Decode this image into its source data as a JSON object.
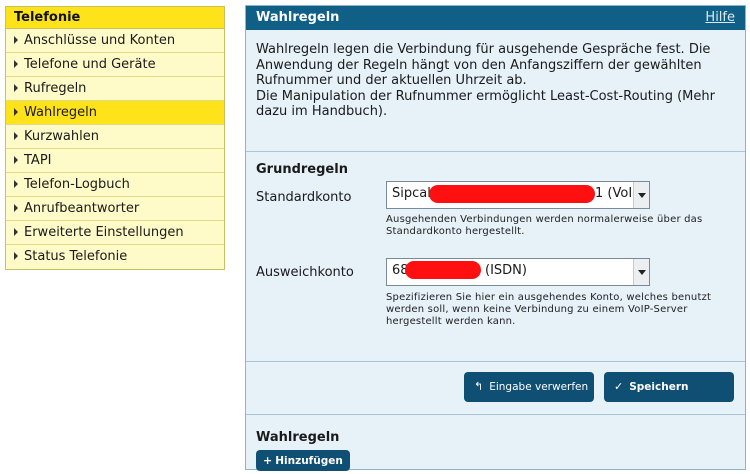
{
  "nav": {
    "title": "Telefonie",
    "items": [
      {
        "label": "Anschlüsse und Konten",
        "active": false
      },
      {
        "label": "Telefone und Geräte",
        "active": false
      },
      {
        "label": "Rufregeln",
        "active": false
      },
      {
        "label": "Wahlregeln",
        "active": true
      },
      {
        "label": "Kurzwahlen",
        "active": false
      },
      {
        "label": "TAPI",
        "active": false
      },
      {
        "label": "Telefon-Logbuch",
        "active": false
      },
      {
        "label": "Anrufbeantworter",
        "active": false
      },
      {
        "label": "Erweiterte Einstellungen",
        "active": false
      },
      {
        "label": "Status Telefonie",
        "active": false
      }
    ]
  },
  "header": {
    "title": "Wahlregeln",
    "help_label": "Hilfe"
  },
  "intro": {
    "line1": "Wahlregeln legen die Verbindung für ausgehende Gespräche fest. Die Anwendung der Regeln hängt von den Anfangsziffern der gewählten Rufnummer und der aktuellen Uhrzeit ab.",
    "line2": "Die Manipulation der Rufnummer ermöglicht Least-Cost-Routing (Mehr dazu im Handbuch)."
  },
  "grundregeln": {
    "title": "Grundregeln",
    "standard": {
      "label": "Standardkonto",
      "value_start": "Sipcall",
      "value_end": "1 (VoI",
      "hint": "Ausgehenden Verbindungen werden normalerweise über das Standardkonto hergestellt."
    },
    "fallback": {
      "label": "Ausweichkonto",
      "value_start": "68",
      "value_end": "(ISDN)",
      "hint": "Spezifizieren Sie hier ein ausgehendes Konto, welches benutzt werden soll, wenn keine Verbindung zu einem VoIP-Server hergestellt werden kann."
    }
  },
  "actions": {
    "discard_label": "Eingabe verwerfen",
    "save_label": "Speichern"
  },
  "rules": {
    "title": "Wahlregeln",
    "add_label": "Hinzufügen"
  },
  "colors": {
    "nav_active": "#ffe31a",
    "nav_bg": "#fffbc8",
    "header_bg": "#0f5f86",
    "panel_bg": "#e6f1f8",
    "button_bg": "#0f4f73",
    "redaction": "#ff1010"
  },
  "icons": {
    "discard": "undo-arrow-icon",
    "save": "checkmark-icon",
    "add": "plus-icon",
    "nav": "triangle-right-icon",
    "select": "chevron-down-icon"
  }
}
